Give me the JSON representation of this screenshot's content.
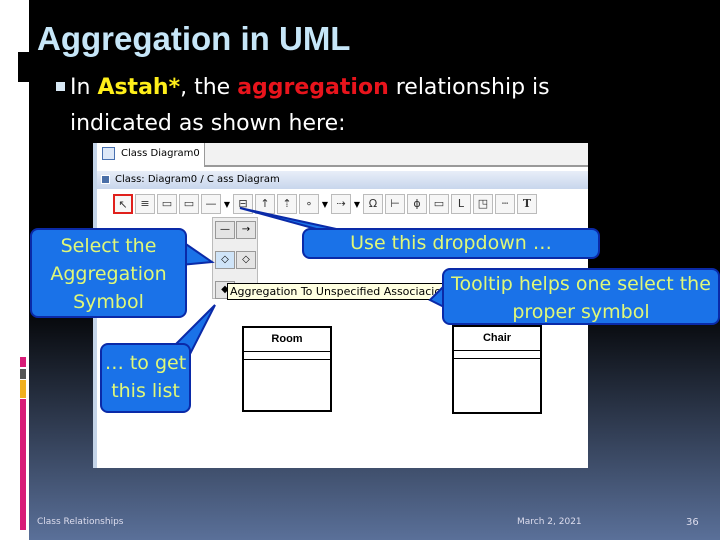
{
  "slide": {
    "title": "Aggregation in UML",
    "bullet_pre": "In ",
    "bullet_app": "Astah*",
    "bullet_mid": ", the ",
    "bullet_term": "aggregation",
    "bullet_post": " relationship is indicated as shown here:"
  },
  "app": {
    "tab": "Class Diagram0",
    "diagram_title": "Class: Diagram0 / C ass Diagram",
    "tooltip": "Aggregation To Unspecified Associacion",
    "classes": [
      "Room",
      "Chair"
    ]
  },
  "callouts": {
    "select": "Select the Aggregation Symbol",
    "dropdown": "Use this dropdown …",
    "tooltip": "Tooltip helps one select the proper symbol",
    "list": "… to get this list"
  },
  "footer": {
    "left": "Class Relationships",
    "date": "March 2, 2021",
    "page": "36"
  },
  "colors": {
    "title": "#c6e6f8",
    "highlight_app": "#ffef1a",
    "highlight_term": "#e8141c",
    "callout": "#1a72e8",
    "callout_text": "#e0f878"
  }
}
